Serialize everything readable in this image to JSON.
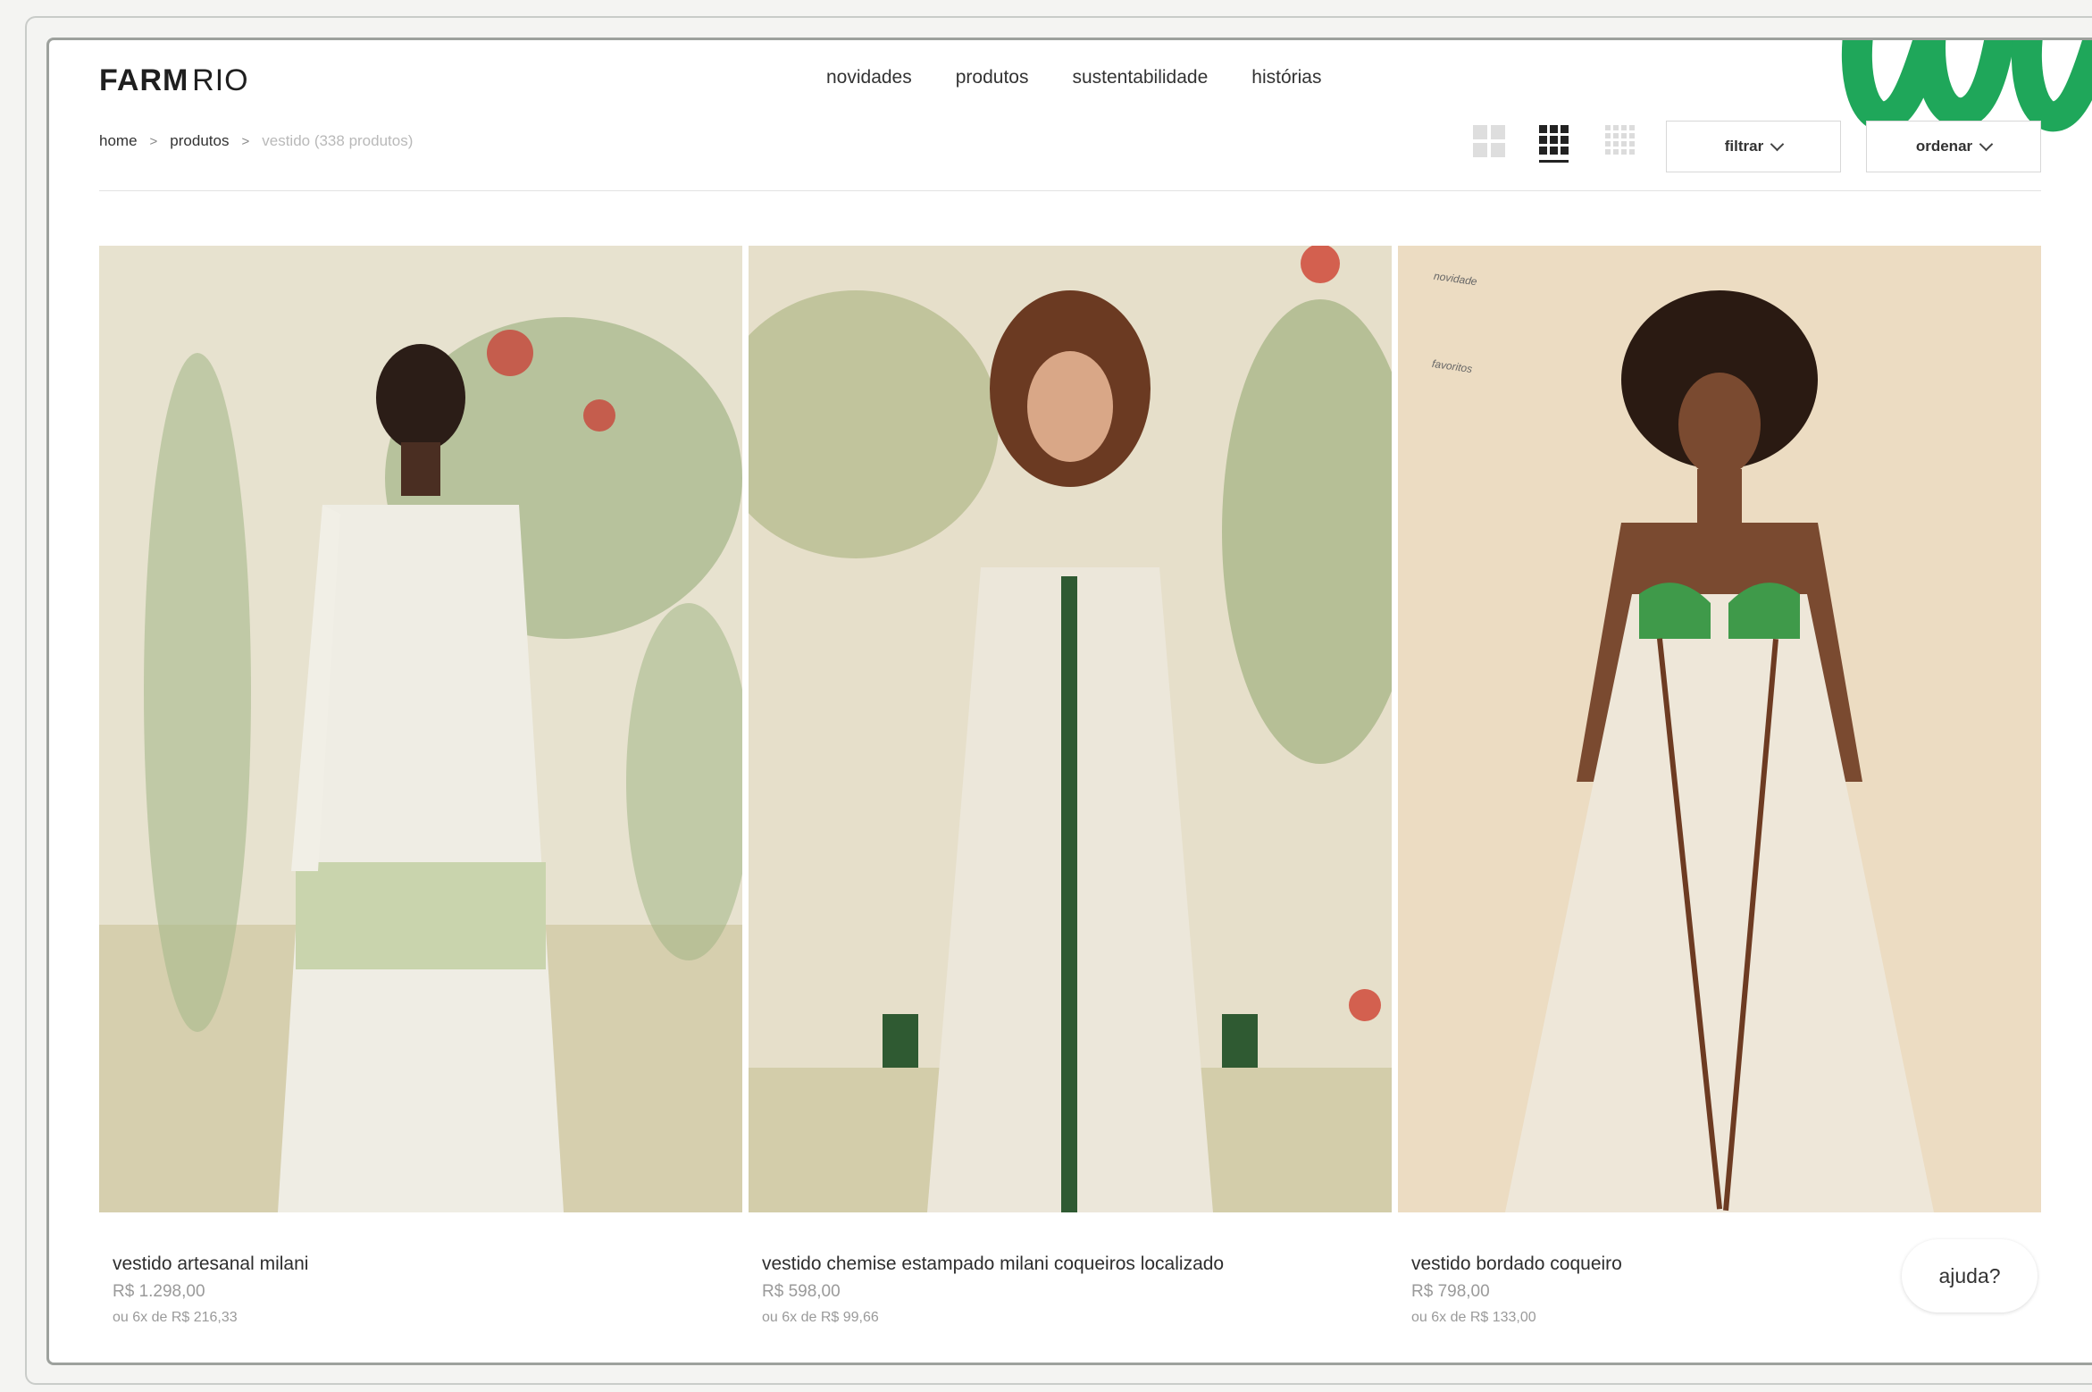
{
  "brand": {
    "name_bold": "FARM",
    "name_light": "RIO"
  },
  "nav": {
    "items": [
      "novidades",
      "produtos",
      "sustentabilidade",
      "histórias"
    ]
  },
  "breadcrumb": {
    "home": "home",
    "produtos": "produtos",
    "current": "vestido (338 produtos)"
  },
  "toolbar": {
    "filter_label": "filtrar",
    "order_label": "ordenar",
    "active_grid": "3-columns"
  },
  "colors": {
    "brand_green": "#1fa75a",
    "accent_dark": "#222222",
    "price_gray": "#9a9a9a"
  },
  "products": [
    {
      "name": "vestido artesanal milani",
      "price": "R$ 1.298,00",
      "installments": "ou 6x de R$ 216,33"
    },
    {
      "name": "vestido chemise estampado milani coqueiros localizado",
      "price": "R$ 598,00",
      "installments": "ou 6x de R$ 99,66"
    },
    {
      "name": "vestido bordado coqueiro",
      "price": "R$ 798,00",
      "installments": "ou 6x de R$ 133,00",
      "badges": [
        "novidade",
        "favoritos"
      ]
    }
  ],
  "help": {
    "label": "ajuda?"
  }
}
